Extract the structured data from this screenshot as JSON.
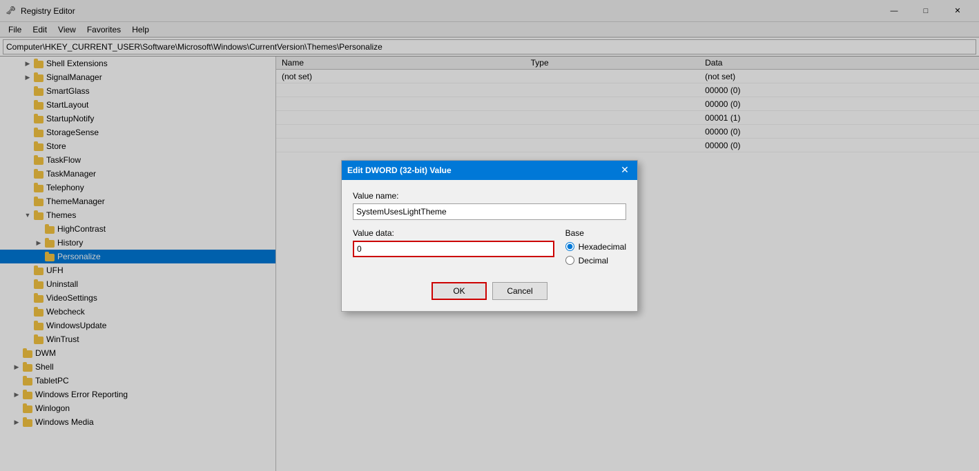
{
  "titleBar": {
    "title": "Registry Editor",
    "icon": "🗝",
    "minBtn": "—",
    "maxBtn": "□",
    "closeBtn": "✕"
  },
  "menuBar": {
    "items": [
      "File",
      "Edit",
      "View",
      "Favorites",
      "Help"
    ]
  },
  "addressBar": {
    "value": "Computer\\HKEY_CURRENT_USER\\Software\\Microsoft\\Windows\\CurrentVersion\\Themes\\Personalize"
  },
  "treeItems": [
    {
      "id": "shell-extensions",
      "label": "Shell Extensions",
      "depth": 2,
      "expandable": true,
      "expanded": false,
      "selected": false
    },
    {
      "id": "signal-manager",
      "label": "SignalManager",
      "depth": 2,
      "expandable": true,
      "expanded": false,
      "selected": false
    },
    {
      "id": "smart-glass",
      "label": "SmartGlass",
      "depth": 2,
      "expandable": false,
      "expanded": false,
      "selected": false
    },
    {
      "id": "start-layout",
      "label": "StartLayout",
      "depth": 2,
      "expandable": false,
      "expanded": false,
      "selected": false
    },
    {
      "id": "startup-notify",
      "label": "StartupNotify",
      "depth": 2,
      "expandable": false,
      "expanded": false,
      "selected": false
    },
    {
      "id": "storage-sense",
      "label": "StorageSense",
      "depth": 2,
      "expandable": false,
      "expanded": false,
      "selected": false
    },
    {
      "id": "store",
      "label": "Store",
      "depth": 2,
      "expandable": false,
      "expanded": false,
      "selected": false
    },
    {
      "id": "task-flow",
      "label": "TaskFlow",
      "depth": 2,
      "expandable": false,
      "expanded": false,
      "selected": false
    },
    {
      "id": "task-manager",
      "label": "TaskManager",
      "depth": 2,
      "expandable": false,
      "expanded": false,
      "selected": false
    },
    {
      "id": "telephony",
      "label": "Telephony",
      "depth": 2,
      "expandable": false,
      "expanded": false,
      "selected": false
    },
    {
      "id": "theme-manager",
      "label": "ThemeManager",
      "depth": 2,
      "expandable": false,
      "expanded": false,
      "selected": false
    },
    {
      "id": "themes",
      "label": "Themes",
      "depth": 2,
      "expandable": true,
      "expanded": true,
      "selected": false
    },
    {
      "id": "high-contrast",
      "label": "HighContrast",
      "depth": 3,
      "expandable": false,
      "expanded": false,
      "selected": false
    },
    {
      "id": "history",
      "label": "History",
      "depth": 3,
      "expandable": true,
      "expanded": false,
      "selected": false
    },
    {
      "id": "personalize",
      "label": "Personalize",
      "depth": 3,
      "expandable": false,
      "expanded": false,
      "selected": true
    },
    {
      "id": "ufh",
      "label": "UFH",
      "depth": 2,
      "expandable": false,
      "expanded": false,
      "selected": false
    },
    {
      "id": "uninstall",
      "label": "Uninstall",
      "depth": 2,
      "expandable": false,
      "expanded": false,
      "selected": false
    },
    {
      "id": "video-settings",
      "label": "VideoSettings",
      "depth": 2,
      "expandable": false,
      "expanded": false,
      "selected": false
    },
    {
      "id": "webcheck",
      "label": "Webcheck",
      "depth": 2,
      "expandable": false,
      "expanded": false,
      "selected": false
    },
    {
      "id": "windows-update",
      "label": "WindowsUpdate",
      "depth": 2,
      "expandable": false,
      "expanded": false,
      "selected": false
    },
    {
      "id": "win-trust",
      "label": "WinTrust",
      "depth": 2,
      "expandable": false,
      "expanded": false,
      "selected": false
    },
    {
      "id": "dwm",
      "label": "DWM",
      "depth": 1,
      "expandable": false,
      "expanded": false,
      "selected": false
    },
    {
      "id": "shell",
      "label": "Shell",
      "depth": 1,
      "expandable": true,
      "expanded": false,
      "selected": false
    },
    {
      "id": "tablet-pc",
      "label": "TabletPC",
      "depth": 1,
      "expandable": false,
      "expanded": false,
      "selected": false
    },
    {
      "id": "windows-error-reporting",
      "label": "Windows Error Reporting",
      "depth": 1,
      "expandable": true,
      "expanded": false,
      "selected": false
    },
    {
      "id": "winlogon",
      "label": "Winlogon",
      "depth": 1,
      "expandable": false,
      "expanded": false,
      "selected": false
    },
    {
      "id": "windows-media",
      "label": "Windows Media",
      "depth": 1,
      "expandable": true,
      "expanded": false,
      "selected": false
    }
  ],
  "dataTable": {
    "columns": [
      "Name",
      "Type",
      "Data"
    ],
    "rows": [
      {
        "name": "(not set)",
        "type": "",
        "data": "(not set)"
      },
      {
        "name": "",
        "type": "",
        "data": "00000 (0)"
      },
      {
        "name": "",
        "type": "",
        "data": "00000 (0)"
      },
      {
        "name": "",
        "type": "",
        "data": "00001 (1)"
      },
      {
        "name": "",
        "type": "",
        "data": "00000 (0)"
      },
      {
        "name": "",
        "type": "",
        "data": "00000 (0)"
      }
    ]
  },
  "modal": {
    "title": "Edit DWORD (32-bit) Value",
    "valueNameLabel": "Value name:",
    "valueName": "SystemUsesLightTheme",
    "valueDataLabel": "Value data:",
    "valueData": "0",
    "baseLabel": "Base",
    "baseOptions": [
      {
        "id": "hex",
        "label": "Hexadecimal",
        "checked": true
      },
      {
        "id": "dec",
        "label": "Decimal",
        "checked": false
      }
    ],
    "okLabel": "OK",
    "cancelLabel": "Cancel"
  }
}
